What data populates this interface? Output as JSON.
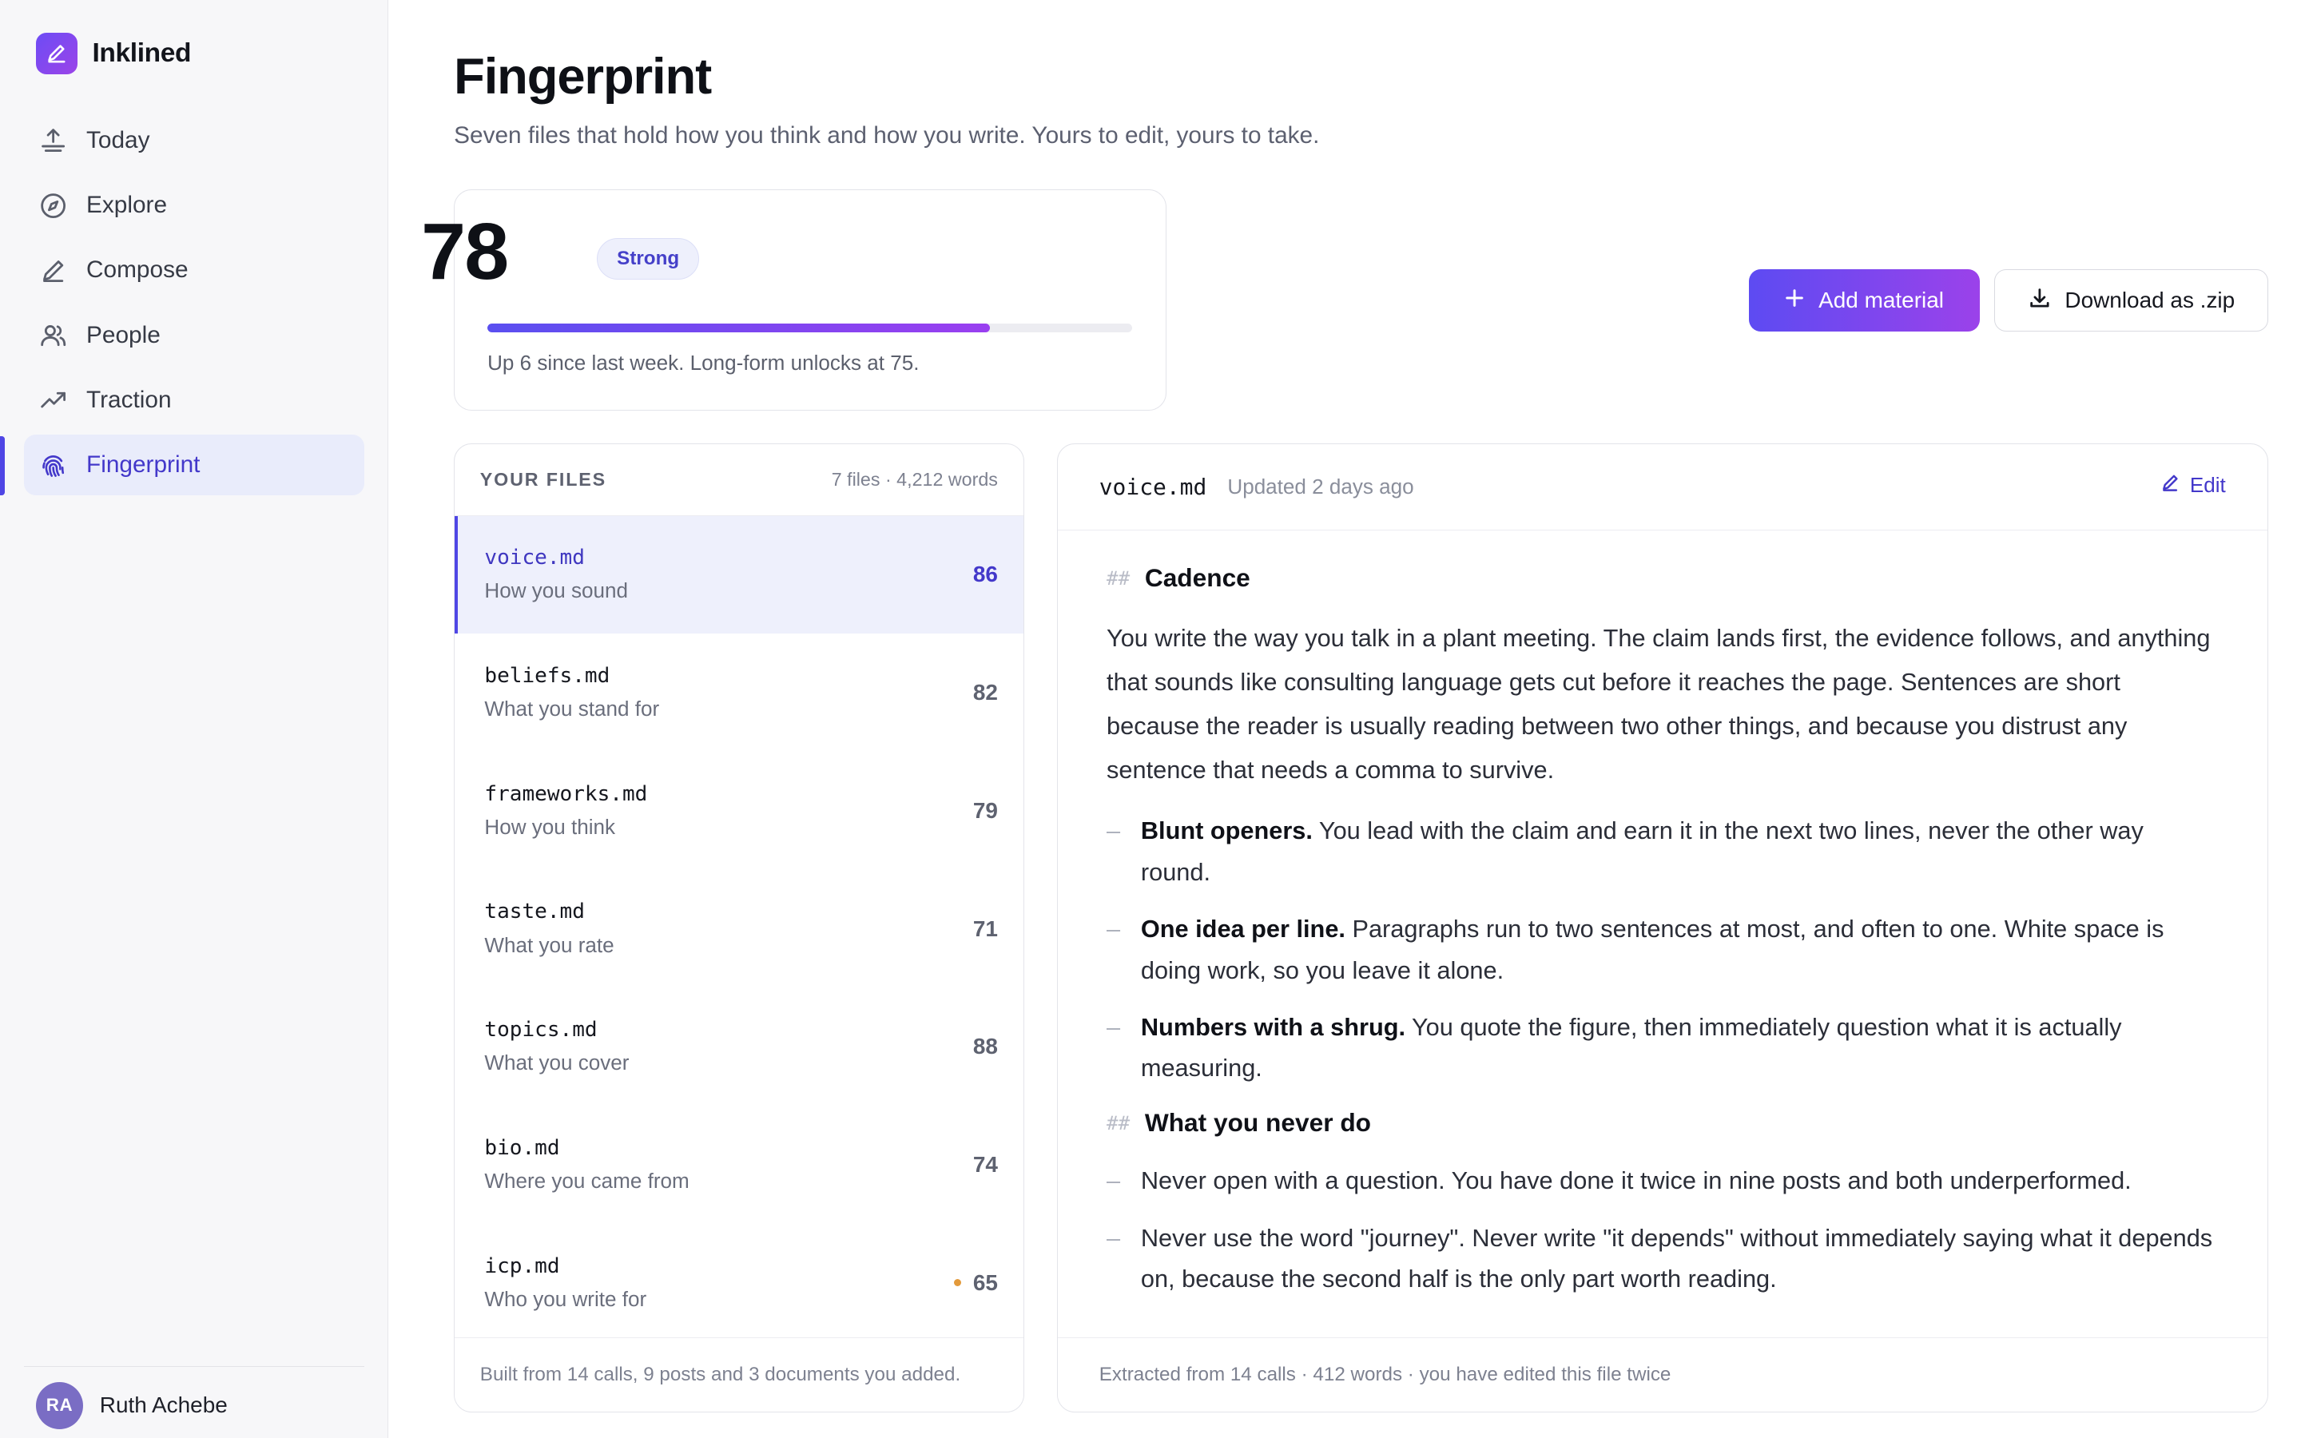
{
  "app": {
    "name": "Inklined"
  },
  "nav": [
    {
      "label": "Today",
      "icon": "today-icon"
    },
    {
      "label": "Explore",
      "icon": "compass-icon"
    },
    {
      "label": "Compose",
      "icon": "pen-icon"
    },
    {
      "label": "People",
      "icon": "people-icon"
    },
    {
      "label": "Traction",
      "icon": "trend-icon"
    },
    {
      "label": "Fingerprint",
      "icon": "fingerprint-icon",
      "active": true
    }
  ],
  "user": {
    "initials": "RA",
    "name": "Ruth Achebe"
  },
  "page": {
    "title": "Fingerprint",
    "subtitle": "Seven files that hold how you think and how you write. Yours to edit, yours to take."
  },
  "score": {
    "value": "78",
    "badge": "Strong",
    "progress_percent": 78,
    "note": "Up 6 since last week. Long-form unlocks at 75."
  },
  "actions": {
    "add_material": "Add material",
    "download": "Download as .zip"
  },
  "files": {
    "heading": "YOUR FILES",
    "meta": "7 files · 4,212 words",
    "items": [
      {
        "name": "voice.md",
        "desc": "How you sound",
        "score": "86",
        "active": true
      },
      {
        "name": "beliefs.md",
        "desc": "What you stand for",
        "score": "82"
      },
      {
        "name": "frameworks.md",
        "desc": "How you think",
        "score": "79"
      },
      {
        "name": "taste.md",
        "desc": "What you rate",
        "score": "71"
      },
      {
        "name": "topics.md",
        "desc": "What you cover",
        "score": "88"
      },
      {
        "name": "bio.md",
        "desc": "Where you came from",
        "score": "74"
      },
      {
        "name": "icp.md",
        "desc": "Who you write for",
        "score": "65",
        "warning": true
      }
    ],
    "footer": "Built from 14 calls, 9 posts and 3 documents you added."
  },
  "preview": {
    "filename": "voice.md",
    "updated": "Updated 2 days ago",
    "edit_label": "Edit",
    "hash": "##",
    "sections": {
      "cadence": {
        "heading": "Cadence",
        "para": "You write the way you talk in a plant meeting. The claim lands first, the evidence follows, and anything that sounds like consulting language gets cut before it reaches the page. Sentences are short because the reader is usually reading between two other things, and because you distrust any sentence that needs a comma to survive.",
        "items": [
          {
            "bold": "Blunt openers.",
            "text": " You lead with the claim and earn it in the next two lines, never the other way round."
          },
          {
            "bold": "One idea per line.",
            "text": " Paragraphs run to two sentences at most, and often to one. White space is doing work, so you leave it alone."
          },
          {
            "bold": "Numbers with a shrug.",
            "text": " You quote the figure, then immediately question what it is actually measuring."
          }
        ]
      },
      "never": {
        "heading": "What you never do",
        "items": [
          "Never open with a question. You have done it twice in nine posts and both underperformed.",
          "Never use the word \"journey\". Never write \"it depends\" without immediately saying what it depends on, because the second half is the only part worth reading."
        ]
      }
    },
    "footer": "Extracted from 14 calls · 412 words · you have edited this file twice"
  }
}
